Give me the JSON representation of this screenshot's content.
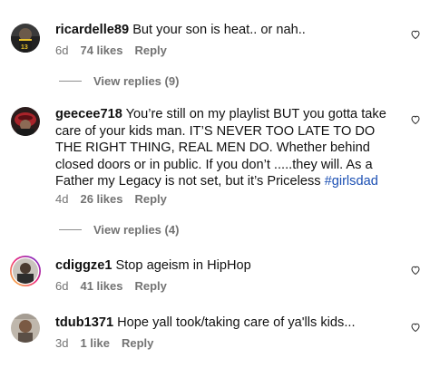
{
  "comments": [
    {
      "username": "ricardelle89",
      "text": "But your son is heat.. or nah..",
      "time": "6d",
      "likes": "74 likes",
      "reply": "Reply",
      "view_replies": "View replies (9)"
    },
    {
      "username": "geecee718",
      "text": "You’re still on my playlist BUT you gotta take care of your kids man. IT’S NEVER TOO LATE TO DO THE RIGHT THING, REAL MEN DO. Whether behind closed doors or in public. If you don’t .....they will. As a Father my Legacy is not set, but it’s Priceless ",
      "hashtag": "#girlsdad",
      "time": "4d",
      "likes": "26 likes",
      "reply": "Reply",
      "view_replies": "View replies (4)"
    },
    {
      "username": "cdiggze1",
      "text": "Stop ageism in HipHop",
      "time": "6d",
      "likes": "41 likes",
      "reply": "Reply"
    },
    {
      "username": "tdub1371",
      "text": "Hope yall took/taking care of ya'lls kids...",
      "time": "3d",
      "likes": "1 like",
      "reply": "Reply"
    }
  ],
  "colors": {
    "text": "#111111",
    "meta": "#737373",
    "hashtag": "#1b4fb3",
    "story_ring": "#d6249f"
  },
  "icons": {
    "like": "heart-outline-icon"
  }
}
